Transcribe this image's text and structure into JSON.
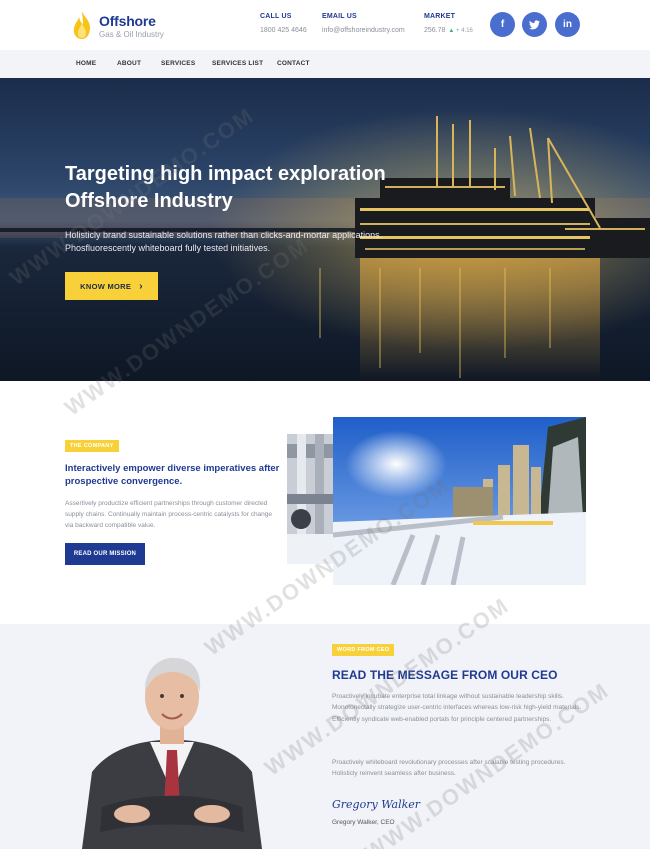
{
  "brand": {
    "title": "Offshore",
    "subtitle": "Gas & Oil Industry"
  },
  "header": {
    "call": {
      "label": "CALL US",
      "value": "1800 425 4646"
    },
    "email": {
      "label": "EMAIL US",
      "value": "info@offshoreindustry.com"
    },
    "market": {
      "label": "MARKET",
      "value": "256.78",
      "change": "+ 4.16"
    },
    "social": [
      {
        "icon": "facebook-icon",
        "glyph": "f"
      },
      {
        "icon": "twitter-icon",
        "glyph": "t"
      },
      {
        "icon": "linkedin-icon",
        "glyph": "in"
      }
    ]
  },
  "nav": [
    "HOME",
    "ABOUT",
    "SERVICES",
    "SERVICES LIST",
    "CONTACT"
  ],
  "hero": {
    "title_line1": "Targeting high impact exploration",
    "title_line2": "Offshore Industry",
    "text_line1": "Holisticly brand sustainable solutions rather than clicks-and-mortar applications.",
    "text_line2": "Phosfluorescently whiteboard fully tested initiatives.",
    "button": "KNOW MORE",
    "button_arrow": "›"
  },
  "company": {
    "tag": "THE COMPANY",
    "heading": "Interactively empower diverse imperatives after prospective convergence.",
    "text": "Assertively productize efficient partnerships through customer directed supply chains. Continually maintain process-centric catalysts for change via backward compatible value.",
    "button": "READ OUR MISSION"
  },
  "ceo": {
    "tag": "WORD FROM CEO",
    "heading": "READ THE MESSAGE FROM OUR CEO",
    "text1": "Proactively incubate enterprise total linkage without sustainable leadership skills. Monotonectally strategize user-centric interfaces whereas low-risk high-yield materials. Efficiently syndicate web-enabled portals for principle centered partnerships.",
    "text2": "Proactively whiteboard revolutionary processes after scalable testing procedures. Holisticly reinvent seamless after business.",
    "signature": "Gregory Walker",
    "name": "Gregory Walker, CEO"
  },
  "watermark": "WWW.DOWNDEMO.COM",
  "colors": {
    "primary": "#1f3a93",
    "accent": "#f8d13a",
    "social": "#4a6ed0"
  }
}
